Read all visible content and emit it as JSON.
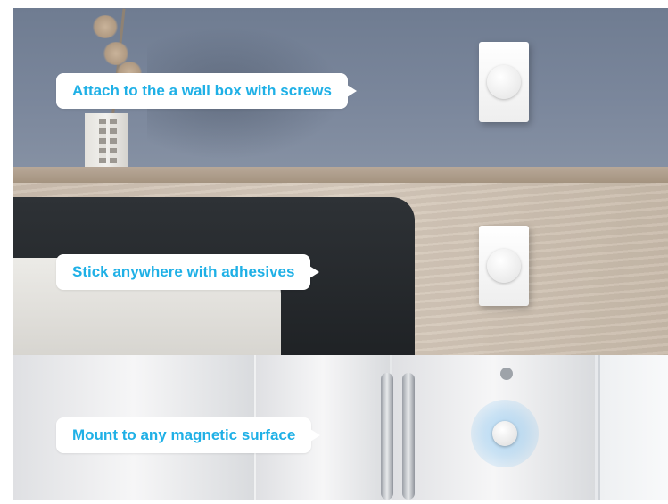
{
  "callouts": {
    "wall_box": "Attach to the  a wall box with screws",
    "adhesive": "Stick anywhere with adhesives",
    "magnetic": "Mount to any magnetic surface"
  },
  "colors": {
    "callout_text": "#1fb0e6",
    "callout_bg": "#ffffff"
  }
}
